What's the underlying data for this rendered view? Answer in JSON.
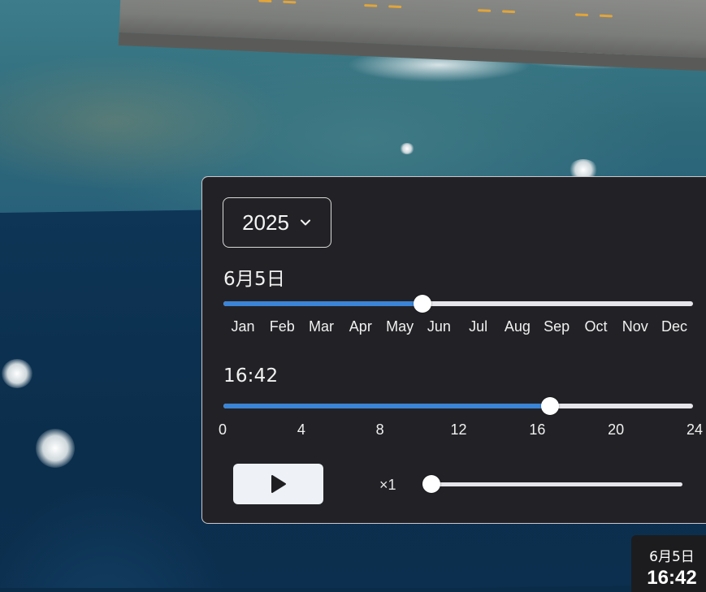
{
  "panel": {
    "year": "2025",
    "date_label": "6月5日",
    "date_progress": 0.424,
    "months": [
      "Jan",
      "Feb",
      "Mar",
      "Apr",
      "May",
      "Jun",
      "Jul",
      "Aug",
      "Sep",
      "Oct",
      "Nov",
      "Dec"
    ],
    "time_label": "16:42",
    "time_value_hours": 16.7,
    "time_ticks": [
      "0",
      "4",
      "8",
      "12",
      "16",
      "20",
      "24"
    ],
    "time_max_hours": 24,
    "speed_label": "×1",
    "speed_progress": 0,
    "accent_color": "#3b84d6"
  },
  "badge": {
    "date": "6月5日",
    "time": "16:42"
  }
}
